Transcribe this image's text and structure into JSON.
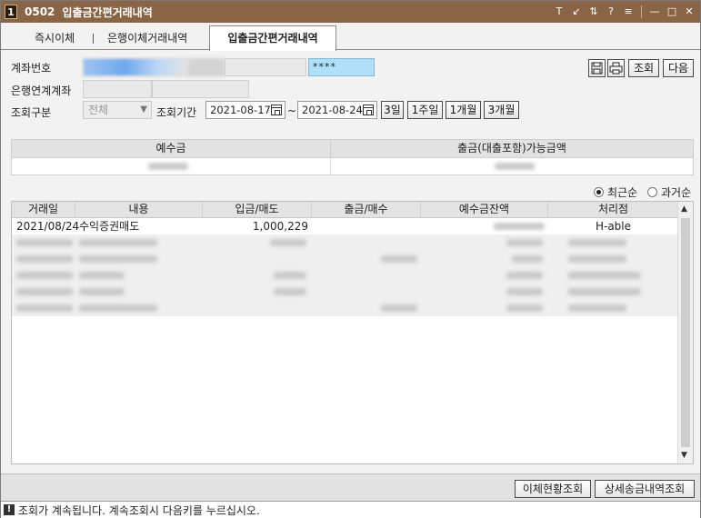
{
  "window": {
    "badge": "1",
    "code": "0502",
    "title": "입출금간편거래내역",
    "controls": [
      "T",
      "↙",
      "⇅",
      "?",
      "≡",
      "—",
      "□",
      "✕"
    ]
  },
  "tabs": [
    {
      "label": "즉시이체",
      "active": false
    },
    {
      "label": "은행이체거래내역",
      "active": false
    },
    {
      "label": "입출금간편거래내역",
      "active": true
    }
  ],
  "form": {
    "account_label": "계좌번호",
    "password_mask": "****",
    "linked_label": "은행연계계좌",
    "type_label": "조회구분",
    "type_value": "전체",
    "period_label": "조회기간",
    "date_from": "2021-08-17",
    "date_sep": "~",
    "date_to": "2021-08-24",
    "ranges": [
      "3일",
      "1주일",
      "1개월",
      "3개월"
    ]
  },
  "buttons": {
    "save_icon": "save-icon",
    "print_icon": "print-icon",
    "query": "조회",
    "next": "다음"
  },
  "balance": {
    "col1": "예수금",
    "col2": "출금(대출포함)가능금액"
  },
  "sort": {
    "recent": "최근순",
    "past": "과거순",
    "selected": "recent"
  },
  "grid": {
    "columns": [
      "거래일",
      "내용",
      "입금/매도",
      "출금/매수",
      "예수금잔액",
      "처리점"
    ],
    "rows": [
      {
        "date": "2021/08/24",
        "desc": "수익증권매도",
        "in": "1,000,229",
        "out": "",
        "balance": "",
        "branch": "H-able"
      }
    ]
  },
  "footer": {
    "transfer_status": "이체현황조회",
    "detail_history": "상세송금내역조회"
  },
  "status": {
    "icon": "!",
    "message": "조회가 계속됩니다. 계속조회시 다음키를 누르십시오."
  }
}
